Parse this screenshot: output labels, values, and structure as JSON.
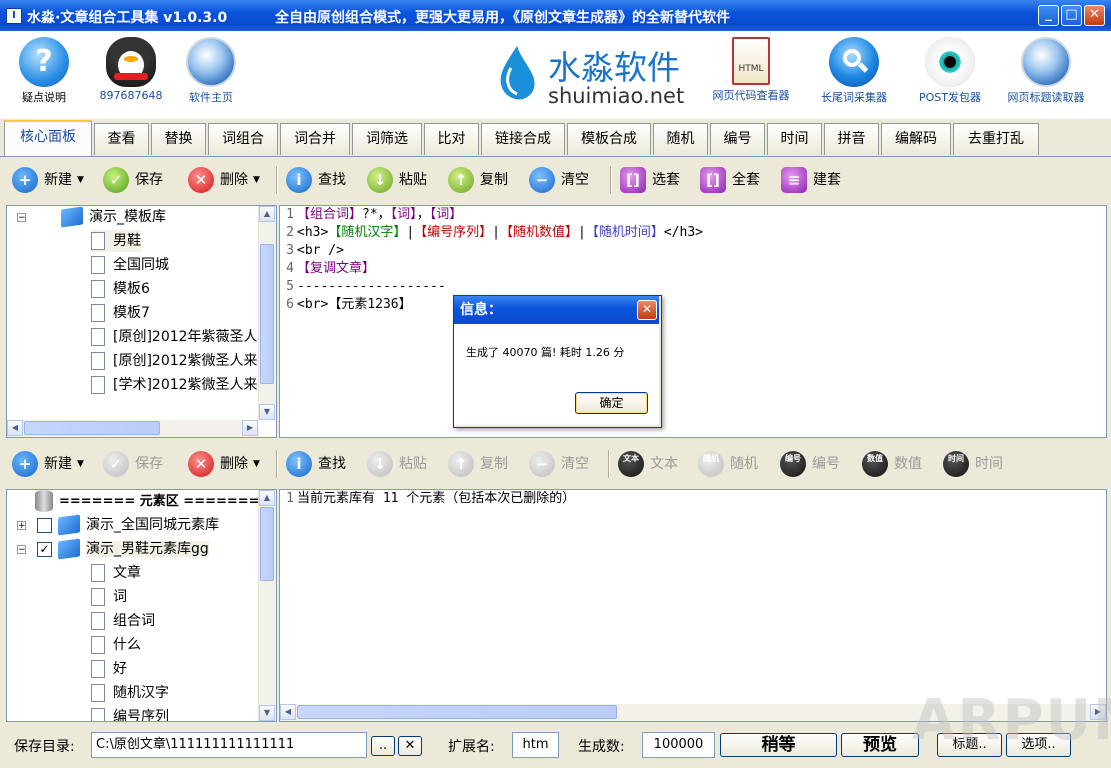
{
  "window": {
    "title": "水淼·文章组合工具集 v1.0.3.0",
    "slogan": "全自由原创组合模式，更强大更易用，《原创文章生成器》的全新替代软件",
    "min_label": "_",
    "max_label": "□",
    "close_label": "✕"
  },
  "banner": {
    "left_items": [
      {
        "label": "疑点说明",
        "icon": "question-icon"
      },
      {
        "label": "897687648",
        "icon": "qq-penguin-icon"
      },
      {
        "label": "软件主页",
        "icon": "globe-icon"
      }
    ],
    "logo_cn": "水淼软件",
    "logo_en": "shuimiao.net",
    "right_items": [
      {
        "label": "网页代码查看器",
        "icon": "html-doc-icon"
      },
      {
        "label": "长尾词采集器",
        "icon": "magnifier-icon"
      },
      {
        "label": "POST发包器",
        "icon": "eye-icon"
      },
      {
        "label": "网页标题读取器",
        "icon": "globe-icon"
      }
    ]
  },
  "tabs": [
    "核心面板",
    "查看",
    "替换",
    "词组合",
    "词合并",
    "词筛选",
    "比对",
    "链接合成",
    "模板合成",
    "随机",
    "编号",
    "时间",
    "拼音",
    "编解码",
    "去重打乱"
  ],
  "toolbar_top": {
    "new": "新建",
    "save": "保存",
    "delete": "删除",
    "find": "查找",
    "paste": "粘贴",
    "copy": "复制",
    "clear": "清空",
    "select_set": "选套",
    "all_set": "全套",
    "build_set": "建套"
  },
  "template_tree": {
    "root": "演示_模板库",
    "items": [
      "男鞋",
      "全国同城",
      "模板6",
      "模板7",
      "[原创]2012年紫薇圣人",
      "[原创]2012紫微圣人来",
      "[学术]2012紫微圣人来"
    ],
    "root_expander": "−"
  },
  "editor_top": {
    "lines": [
      [
        {
          "t": "【组合词】",
          "c": "c-purple"
        },
        {
          "t": "?*，",
          "c": "c-black"
        },
        {
          "t": "【词】",
          "c": "c-purple"
        },
        {
          "t": "，",
          "c": "c-black"
        },
        {
          "t": "【词】",
          "c": "c-purple"
        }
      ],
      [
        {
          "t": "<h3>",
          "c": "c-black"
        },
        {
          "t": "【随机汉字】",
          "c": "c-green"
        },
        {
          "t": "|",
          "c": "c-black"
        },
        {
          "t": "【编号序列】",
          "c": "c-red"
        },
        {
          "t": "|",
          "c": "c-black"
        },
        {
          "t": "【随机数值】",
          "c": "c-red"
        },
        {
          "t": "|",
          "c": "c-black"
        },
        {
          "t": "【随机时间】",
          "c": "c-blue"
        },
        {
          "t": "</h3>",
          "c": "c-black"
        }
      ],
      [
        {
          "t": "<br />",
          "c": "c-black"
        }
      ],
      [
        {
          "t": "【复调文章】",
          "c": "c-purple"
        }
      ],
      [
        {
          "t": "-------------------",
          "c": "c-black"
        }
      ],
      [
        {
          "t": "<br>",
          "c": "c-black"
        },
        {
          "t": "【元素1236】",
          "c": "c-black"
        }
      ]
    ]
  },
  "dialog": {
    "title": "信息：",
    "message": "生成了 40070 篇! 耗时 1.26 分",
    "ok": "确定",
    "close": "✕"
  },
  "toolbar_bottom": {
    "new": "新建",
    "save": "保存",
    "delete": "删除",
    "find": "查找",
    "paste": "粘贴",
    "copy": "复制",
    "clear": "清空",
    "text": "文本",
    "random": "随机",
    "number": "编号",
    "value": "数值",
    "time": "时间",
    "text_glyph": "文本",
    "random_glyph": "随机",
    "number_glyph": "编号",
    "value_glyph": "数值",
    "time_glyph": "时间"
  },
  "element_tree": {
    "header": "======= 元素区 =======",
    "libs": [
      {
        "label": "演示_全国同城元素库",
        "checked": false,
        "expander": "+"
      },
      {
        "label": "演示_男鞋元素库gg",
        "checked": true,
        "expander": "−"
      }
    ],
    "checkmark": "✓",
    "items": [
      "文章",
      "词",
      "组合词",
      "什么",
      "好",
      "随机汉字",
      "编号序列"
    ]
  },
  "editor_bottom": {
    "line_no": "1",
    "text": "当前元素库有 11 个元素（包括本次已删除的）"
  },
  "status": {
    "save_dir_label": "保存目录:",
    "save_dir": "C:\\原创文章\\111111111111111",
    "browse": "..",
    "clear_x": "✕",
    "ext_label": "扩展名:",
    "ext": "htm",
    "count_label": "生成数:",
    "count": "100000",
    "wait": "稍等",
    "preview": "预览",
    "title_btn": "标题..",
    "options_btn": "选项.."
  },
  "watermark": "ARPUN",
  "colors": {
    "accent": "#0a54dc",
    "tab_highlight": "#ffc83c"
  }
}
